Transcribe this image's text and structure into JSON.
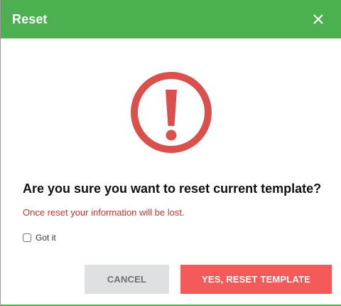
{
  "dialog": {
    "title": "Reset",
    "close_icon": "close-icon",
    "warning_icon": "exclamation-circle-icon",
    "question": "Are you sure you want to reset current template?",
    "warning_text": "Once reset your information will be lost.",
    "checkbox_label": "Got it",
    "checkbox_checked": false,
    "cancel_label": "CANCEL",
    "confirm_label": "YES, RESET TEMPLATE"
  },
  "colors": {
    "header": "#4caf50",
    "warning": "#d9504c",
    "confirm_button": "#f55a5a",
    "cancel_button": "#dfe0e1"
  }
}
